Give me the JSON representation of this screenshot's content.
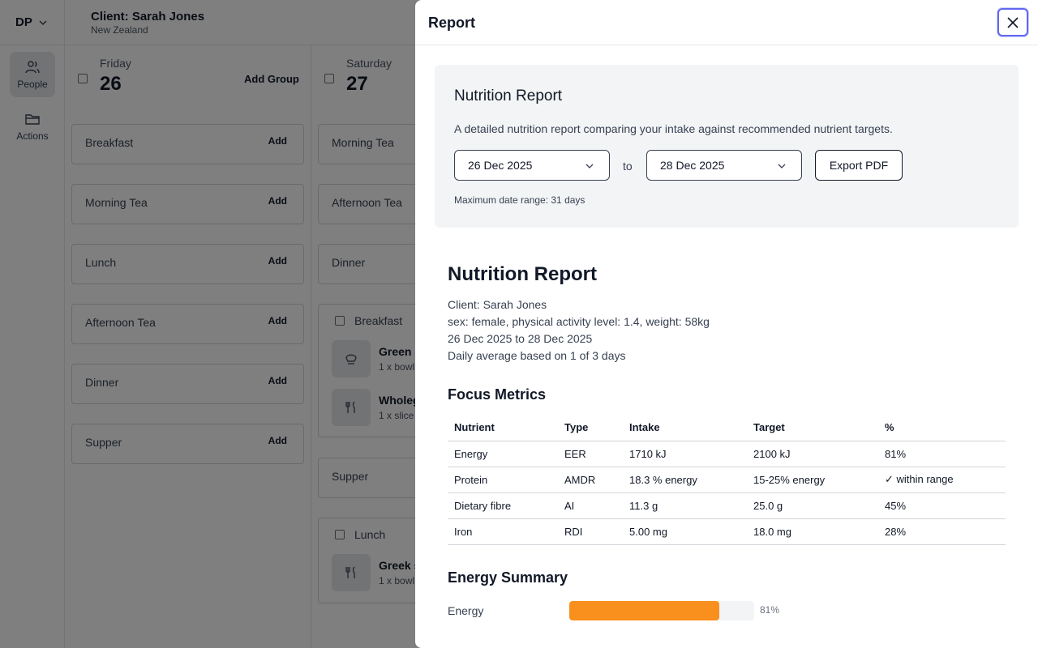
{
  "topbar": {
    "account": "DP",
    "client_name": "Client: Sarah Jones",
    "client_region": "New Zealand"
  },
  "sidebar": {
    "items": [
      {
        "label": "People",
        "icon": "people-icon"
      },
      {
        "label": "Actions",
        "icon": "folder-icon"
      }
    ]
  },
  "days": [
    {
      "name": "Friday",
      "date": "26",
      "add_group": "Add Group",
      "meals": [
        {
          "name": "Breakfast",
          "add": "Add"
        },
        {
          "name": "Morning Tea",
          "add": "Add"
        },
        {
          "name": "Lunch",
          "add": "Add"
        },
        {
          "name": "Afternoon Tea",
          "add": "Add"
        },
        {
          "name": "Dinner",
          "add": "Add"
        },
        {
          "name": "Supper",
          "add": "Add"
        }
      ]
    },
    {
      "name": "Saturday",
      "date": "27",
      "meals": [
        {
          "name": "Morning Tea"
        },
        {
          "name": "Afternoon Tea"
        },
        {
          "name": "Dinner"
        },
        {
          "name": "Supper"
        }
      ],
      "groups": [
        {
          "title": "Breakfast",
          "foods": [
            {
              "name": "Green S",
              "qty": "1 x bowl",
              "icon": "bowl-icon"
            },
            {
              "name": "Wholeg",
              "qty": "1 x slice",
              "icon": "cutlery-icon"
            }
          ]
        },
        {
          "title": "Lunch",
          "foods": [
            {
              "name": "Greek s",
              "qty": "1 x bowl",
              "icon": "cutlery-icon"
            }
          ]
        }
      ]
    }
  ],
  "modal": {
    "title": "Report",
    "panel": {
      "title": "Nutrition Report",
      "description": "A detailed nutrition report comparing your intake against recommended nutrient targets.",
      "start_date": "26 Dec 2025",
      "to_label": "to",
      "end_date": "28 Dec 2025",
      "export_label": "Export PDF",
      "range_note": "Maximum date range: 31 days"
    },
    "report": {
      "title": "Nutrition Report",
      "client": "Client: Sarah Jones",
      "profile": "sex: female, physical activity level: 1.4, weight: 58kg",
      "date_range": "26 Dec 2025 to 28 Dec 2025",
      "average_note": "Daily average based on 1 of 3 days",
      "focus_title": "Focus Metrics",
      "columns": [
        "Nutrient",
        "Type",
        "Intake",
        "Target",
        "%"
      ],
      "rows": [
        [
          "Energy",
          "EER",
          "1710 kJ",
          "2100 kJ",
          "81%"
        ],
        [
          "Protein",
          "AMDR",
          "18.3 % energy",
          "15-25% energy",
          "✓ within range"
        ],
        [
          "Dietary fibre",
          "AI",
          "11.3 g",
          "25.0 g",
          "45%"
        ],
        [
          "Iron",
          "RDI",
          "5.00 mg",
          "18.0 mg",
          "28%"
        ]
      ],
      "energy_summary_title": "Energy Summary",
      "energy_label": "Energy",
      "energy_percent": 81,
      "energy_percent_text": "81%"
    }
  },
  "colors": {
    "accent": "#6366f1",
    "energy_bar": "#f98f1d"
  }
}
